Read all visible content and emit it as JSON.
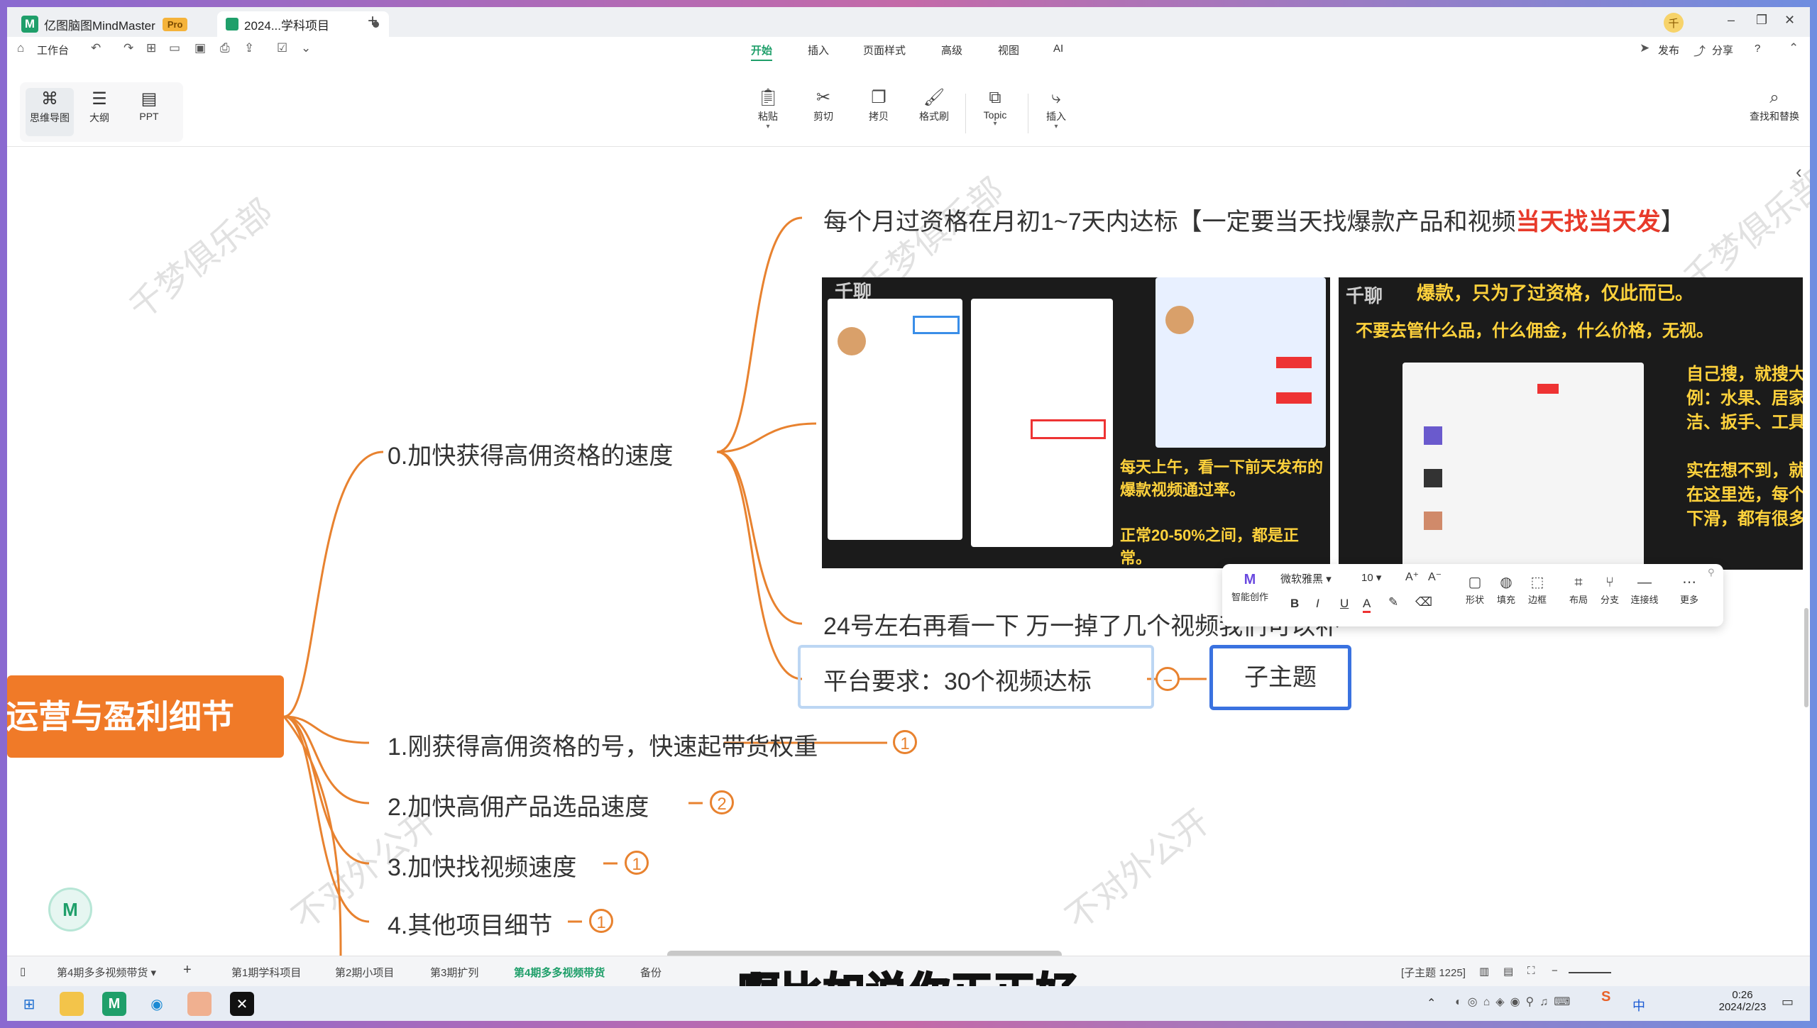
{
  "window": {
    "app_name": "亿图脑图MindMaster",
    "pro_badge": "Pro",
    "doc_tab": "2024...学科项目",
    "avatar": "千",
    "new_tab": "+",
    "min": "–",
    "restore": "❐",
    "close": "✕"
  },
  "menubar": {
    "workbench": "工作台",
    "tabs": [
      "开始",
      "插入",
      "页面样式",
      "高级",
      "视图",
      "AI"
    ],
    "publish": "发布",
    "share": "分享",
    "help": "?"
  },
  "ribbon": {
    "view_modes": [
      "思维导图",
      "大纲",
      "PPT"
    ],
    "tools": [
      "粘贴",
      "剪切",
      "拷贝",
      "格式刷",
      "Topic",
      "插入"
    ],
    "find_replace": "查找和替换"
  },
  "canvas": {
    "watermarks": [
      "千梦俱乐部",
      "千梦俱乐部",
      "不对外公开",
      "不对外公开",
      "千梦俱乐部"
    ],
    "root": "运营与盈利细节",
    "branch0": "0.加快获得高佣资格的速度",
    "b0_text1_main": "每个月过资格在月初1~7天内达标【一定要当天找爆款产品和视频",
    "b0_text1_red": "当天找当天发",
    "b0_text1_end": "】",
    "b0_text2": "24号左右再看一下  万一掉了几个视频我们可以补",
    "b0_selected": "平台要求：30个视频达标",
    "subtopic": "子主题",
    "collapse": "−",
    "branches": [
      {
        "label": "1.刚获得高佣资格的号，快速起带货权重",
        "badge": "1"
      },
      {
        "label": "2.加快高佣产品选品速度",
        "badge": "2"
      },
      {
        "label": "3.加快找视频速度",
        "badge": "1"
      },
      {
        "label": "4.其他项目细节",
        "badge": "1"
      }
    ],
    "img1": {
      "brand": "千聊",
      "overlay": "每天上午，看一下前天发布的爆款视频通过率。\n\n正常20-50%之间，都是正常。"
    },
    "img2": {
      "brand": "千聊",
      "top": "爆款，只为了过资格，仅此而已。",
      "line2": "不要去管什么品，什么佣金，什么价格，无视。",
      "right": "自己搜，就搜大\n例：水果、居家\n洁、扳手、工具\n\n实在想不到，就\n在这里选，每个\n下滑，都有很多"
    }
  },
  "float_toolbar": {
    "ai_label": "智能创作",
    "font": "微软雅黑",
    "size": "10",
    "grow": "A⁺",
    "shrink": "A⁻",
    "bold": "B",
    "italic": "I",
    "underline": "U",
    "fontcolor": "A",
    "items": [
      "形状",
      "填充",
      "边框",
      "布局",
      "分支",
      "连接线",
      "更多"
    ]
  },
  "statusbar": {
    "sheets": [
      "第4期多多视频带货",
      "第1期学科项目",
      "第2期小项目",
      "第3期扩列",
      "第4期多多视频带货",
      "备份"
    ],
    "add_sheet": "+",
    "info": "[子主题 1225]"
  },
  "taskbar": {
    "ime": "中",
    "time": "0:26",
    "date": "2024/2/23"
  },
  "subtitle": "啊比如说你正正好"
}
